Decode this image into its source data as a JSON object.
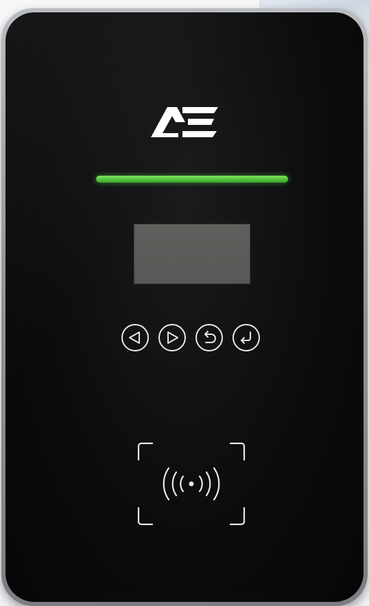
{
  "device": {
    "brand_logo_text": "AE",
    "status_light": {
      "color": "#52c43a",
      "state": "on"
    },
    "display": {
      "content": ""
    },
    "keys": [
      {
        "name": "left-arrow-icon"
      },
      {
        "name": "right-arrow-icon"
      },
      {
        "name": "back-icon"
      },
      {
        "name": "enter-icon"
      }
    ],
    "card_reader": {
      "icon": "rfid-contactless-icon"
    }
  },
  "colors": {
    "face": "#0d0d0e",
    "frame": "#9a9da1",
    "lcd": "#5b5d5a",
    "icon_stroke": "#e9e9e9",
    "logo": "#ffffff"
  }
}
